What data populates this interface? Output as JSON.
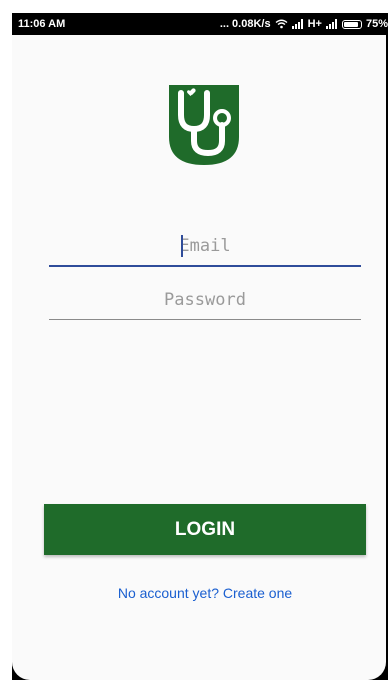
{
  "status_bar": {
    "time": "11:06 AM",
    "network_speed": "... 0.08K/s",
    "network_type": "H+",
    "battery_level": "75%"
  },
  "login_form": {
    "email_placeholder": "Email",
    "password_placeholder": "Password",
    "login_label": "LOGIN",
    "create_account_link": "No account yet? Create one"
  },
  "colors": {
    "brand_green": "#1f6b2a",
    "link_blue": "#1a5fd0",
    "focus_underline": "#2f4c9a"
  },
  "icons": [
    "stethoscope-logo-icon",
    "wifi-icon",
    "signal-icon",
    "battery-icon"
  ]
}
